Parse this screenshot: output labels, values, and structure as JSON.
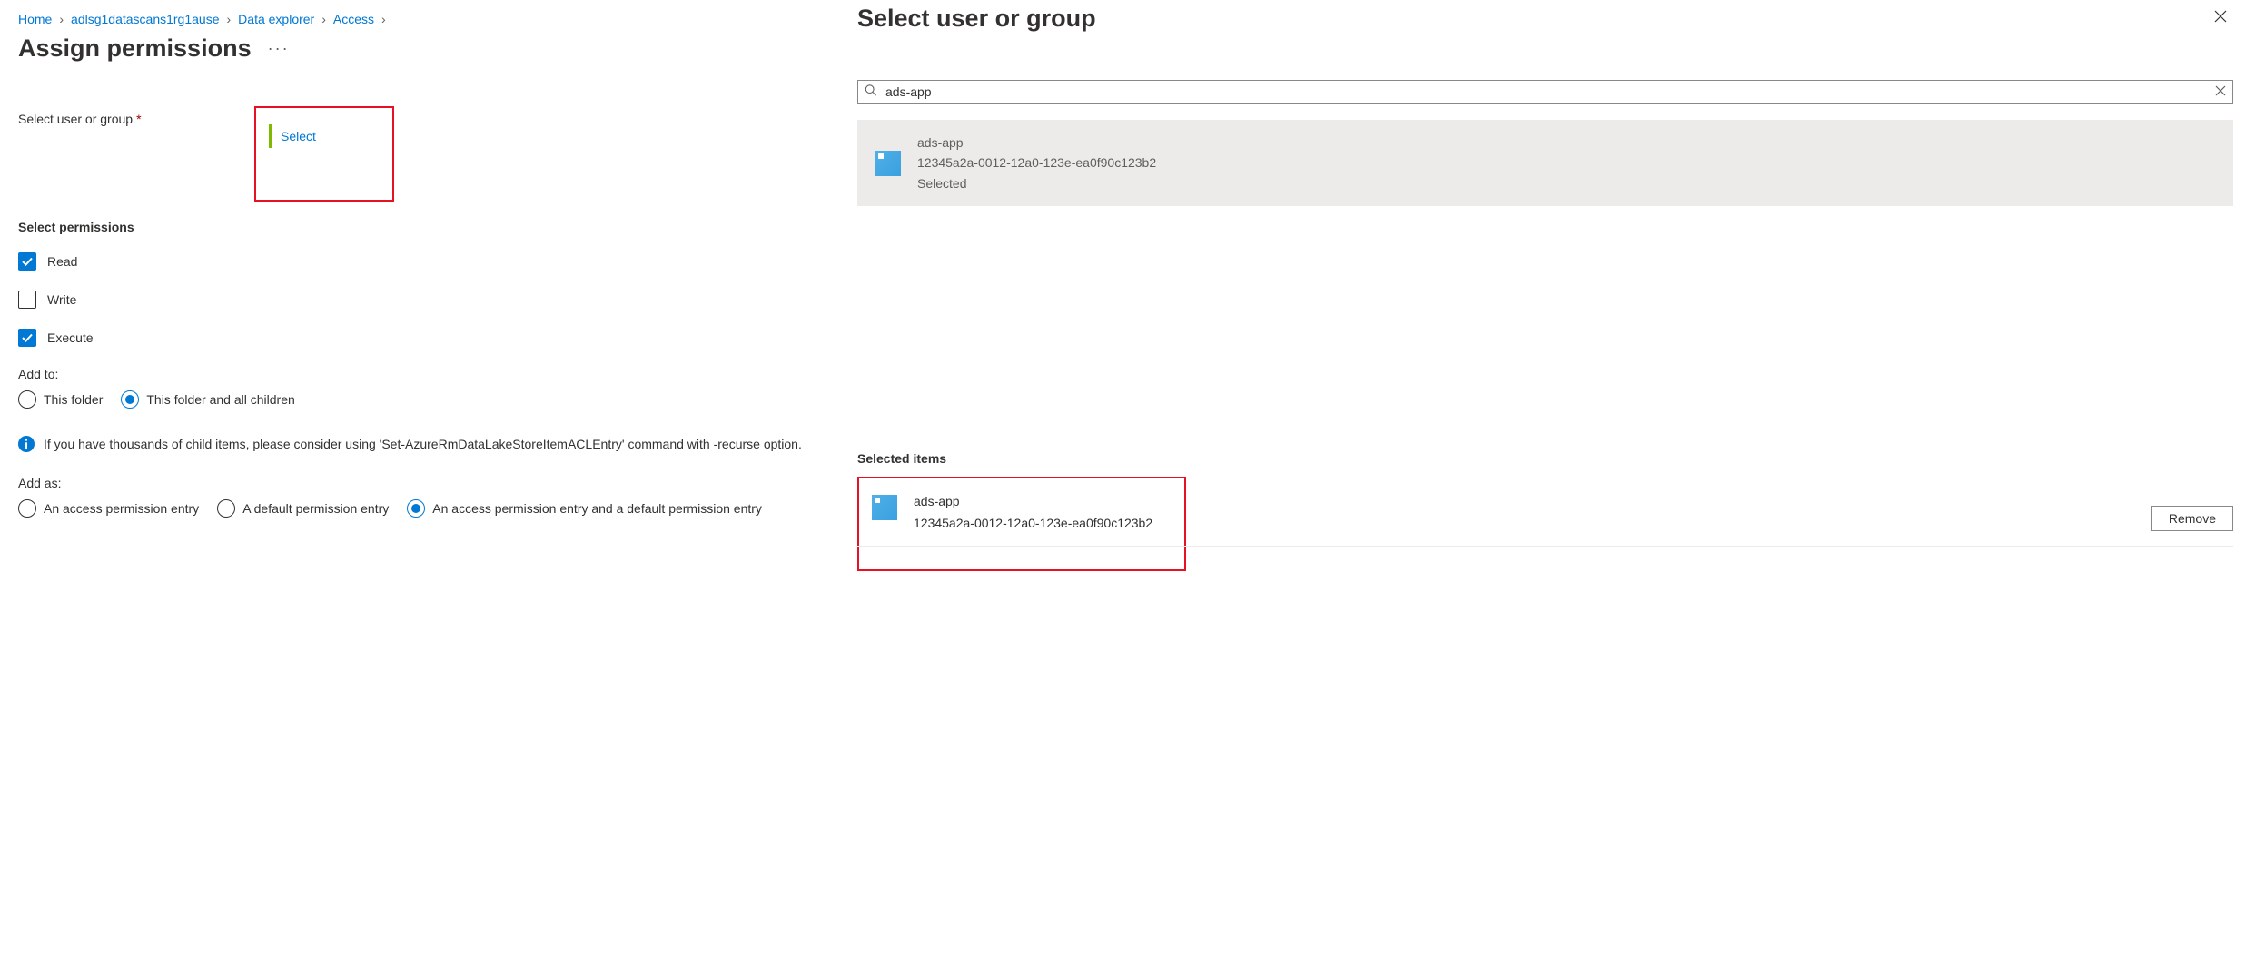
{
  "breadcrumb": {
    "items": [
      "Home",
      "adlsg1datascans1rg1ause",
      "Data explorer",
      "Access"
    ]
  },
  "page": {
    "title": "Assign permissions"
  },
  "fields": {
    "select_user_label": "Select user or group",
    "select_link": "Select",
    "select_permissions_heading": "Select permissions"
  },
  "permissions": {
    "read": {
      "label": "Read",
      "checked": true
    },
    "write": {
      "label": "Write",
      "checked": false
    },
    "execute": {
      "label": "Execute",
      "checked": true
    }
  },
  "add_to": {
    "label": "Add to:",
    "options": [
      "This folder",
      "This folder and all children"
    ],
    "selected_index": 1
  },
  "info_text": "If you have thousands of child items, please consider using 'Set-AzureRmDataLakeStoreItemACLEntry' command with -recurse option.",
  "add_as": {
    "label": "Add as:",
    "options": [
      "An access permission entry",
      "A default permission entry",
      "An access permission entry and a default permission entry"
    ],
    "selected_index": 2
  },
  "panel": {
    "title": "Select user or group",
    "search_value": "ads-app",
    "result": {
      "name": "ads-app",
      "id": "12345a2a-0012-12a0-123e-ea0f90c123b2",
      "status": "Selected"
    },
    "selected_heading": "Selected items",
    "selected_item": {
      "name": "ads-app",
      "id": "12345a2a-0012-12a0-123e-ea0f90c123b2"
    },
    "remove_label": "Remove"
  }
}
